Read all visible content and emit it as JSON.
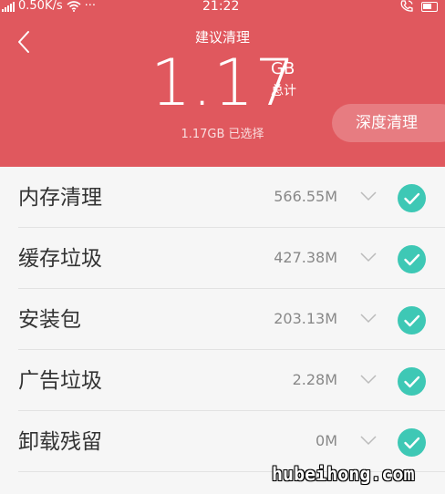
{
  "status_bar": {
    "network_speed": "0.50K/s",
    "more": "···",
    "time": "21:22"
  },
  "header": {
    "title": "建议清理",
    "total_size": "1.17",
    "unit": "GB",
    "total_label": "总计",
    "selected_info": "1.17GB 已选择",
    "deep_clean_label": "深度清理",
    "background_color": "#e0585e"
  },
  "items": [
    {
      "label": "内存清理",
      "size": "566.55M",
      "checked": true
    },
    {
      "label": "缓存垃圾",
      "size": "427.38M",
      "checked": true
    },
    {
      "label": "安装包",
      "size": "203.13M",
      "checked": true
    },
    {
      "label": "广告垃圾",
      "size": "2.28M",
      "checked": true
    },
    {
      "label": "卸载残留",
      "size": "0M",
      "checked": true
    }
  ],
  "check_color": "#3ec8b5",
  "watermark": "hubeihong.com"
}
